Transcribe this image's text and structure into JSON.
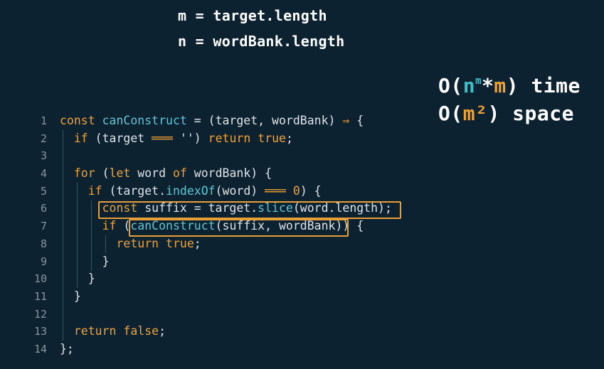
{
  "header": {
    "m_definition": "m = target.length",
    "n_definition": "n = wordBank.length"
  },
  "complexity": {
    "time_prefix": "O(",
    "time_n": "n",
    "time_exp": "m",
    "time_star": "*",
    "time_m": "m",
    "time_suffix": ") time",
    "space_prefix": "O(",
    "space_m": "m²",
    "space_suffix": ") space"
  },
  "code": {
    "line_numbers": [
      "1",
      "2",
      "3",
      "4",
      "5",
      "6",
      "7",
      "8",
      "9",
      "10",
      "11",
      "12",
      "13",
      "14"
    ],
    "lines": [
      "const canConstruct = (target, wordBank) ⇒ {",
      "  if (target ═══ '') return true;",
      "",
      "  for (let word of wordBank) {",
      "    if (target.indexOf(word) ═══ 0) {",
      "      const suffix = target.slice(word.length);",
      "      if (canConstruct(suffix, wordBank)) {",
      "        return true;",
      "      }",
      "    }",
      "  }",
      "",
      "  return false;",
      "};"
    ]
  },
  "colors": {
    "background": "#0c2231",
    "keyword": "#f0a235",
    "function": "#5ec7d6",
    "highlight_box": "#e89f37"
  }
}
